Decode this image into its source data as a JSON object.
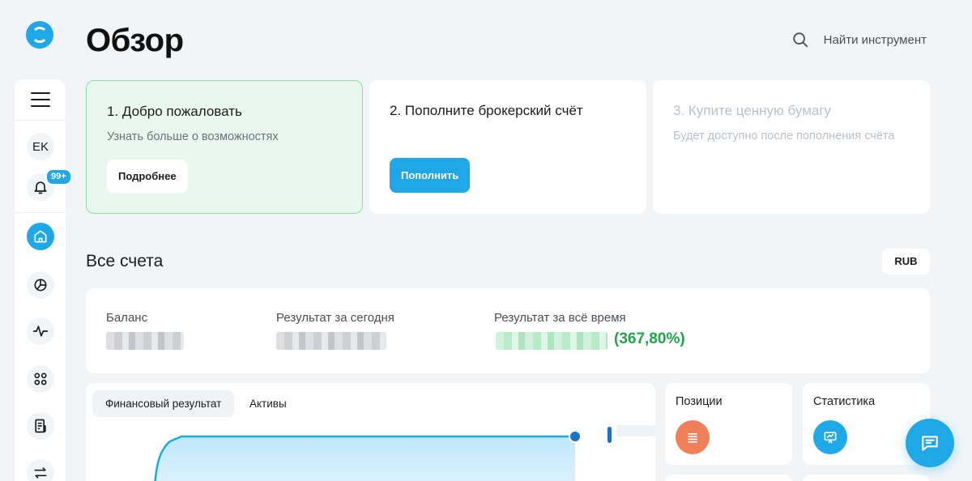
{
  "header": {
    "title": "Обзор",
    "search_label": "Найти инструмент"
  },
  "sidebar": {
    "avatar_initials": "EK",
    "notifications_badge": "99+",
    "items": [
      {
        "name": "home",
        "icon": "home-icon",
        "active": true
      },
      {
        "name": "portfolio",
        "icon": "pie-chart-icon"
      },
      {
        "name": "pulse",
        "icon": "pulse-icon"
      },
      {
        "name": "catalog",
        "icon": "grid-icon"
      },
      {
        "name": "documents",
        "icon": "document-icon"
      },
      {
        "name": "transfers",
        "icon": "transfer-arrows-icon"
      }
    ]
  },
  "onboarding": [
    {
      "title": "1. Добро пожаловать",
      "subtitle": "Узнать больше о возможностях",
      "button": "Подробнее"
    },
    {
      "title": "2. Пополните брокерский счёт",
      "subtitle": "",
      "button": "Пополнить"
    },
    {
      "title": "3. Купите ценную бумагу",
      "subtitle": "Будет доступно после пополнения счёта",
      "disabled": true
    }
  ],
  "accounts": {
    "title": "Все счета",
    "currency": "RUB",
    "balance_label": "Баланс",
    "today_label": "Результат за сегодня",
    "alltime_label": "Результат за всё время",
    "alltime_percent": "(367,80%)"
  },
  "chart_panel": {
    "tabs": [
      "Финансовый результат",
      "Активы"
    ]
  },
  "widgets": [
    {
      "title": "Позиции",
      "icon": "list-icon",
      "color": "#f0805a"
    },
    {
      "title": "Статистика",
      "icon": "presentation-chart-icon",
      "color": "#1fa8e8"
    }
  ],
  "colors": {
    "accent": "#1fa8e8",
    "positive": "#1fa64a",
    "welcome_bg": "#e9f8ee"
  }
}
